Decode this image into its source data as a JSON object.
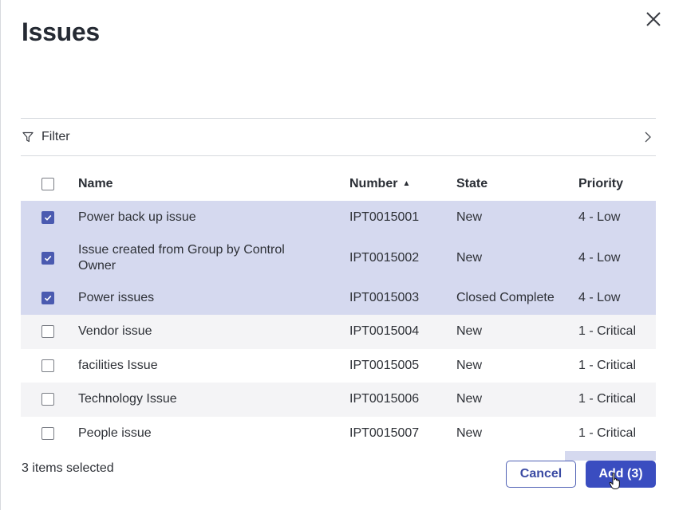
{
  "dialog": {
    "title": "Issues"
  },
  "filter": {
    "label": "Filter"
  },
  "table": {
    "columns": [
      "Name",
      "Number",
      "State",
      "Priority"
    ],
    "sort_indicator": "▲",
    "rows": [
      {
        "name": "Power back up issue",
        "number": "IPT0015001",
        "state": "New",
        "priority": "4 - Low",
        "checked": true
      },
      {
        "name": "Issue created from Group by Control Owner",
        "number": "IPT0015002",
        "state": "New",
        "priority": "4 - Low",
        "checked": true
      },
      {
        "name": "Power issues",
        "number": "IPT0015003",
        "state": "Closed Complete",
        "priority": "4 - Low",
        "checked": true
      },
      {
        "name": "Vendor issue",
        "number": "IPT0015004",
        "state": "New",
        "priority": "1 - Critical",
        "checked": false
      },
      {
        "name": "facilities Issue",
        "number": "IPT0015005",
        "state": "New",
        "priority": "1 - Critical",
        "checked": false
      },
      {
        "name": "Technology Issue",
        "number": "IPT0015006",
        "state": "New",
        "priority": "1 - Critical",
        "checked": false
      },
      {
        "name": "People issue",
        "number": "IPT0015007",
        "state": "New",
        "priority": "1 - Critical",
        "checked": false
      }
    ]
  },
  "footer": {
    "selection_text": "3 items selected",
    "cancel_label": "Cancel",
    "add_label": "Add (3)"
  },
  "colors": {
    "accent": "#3a4dc0",
    "selected_row": "#d5d9ef",
    "alt_row": "#f4f4f6"
  }
}
